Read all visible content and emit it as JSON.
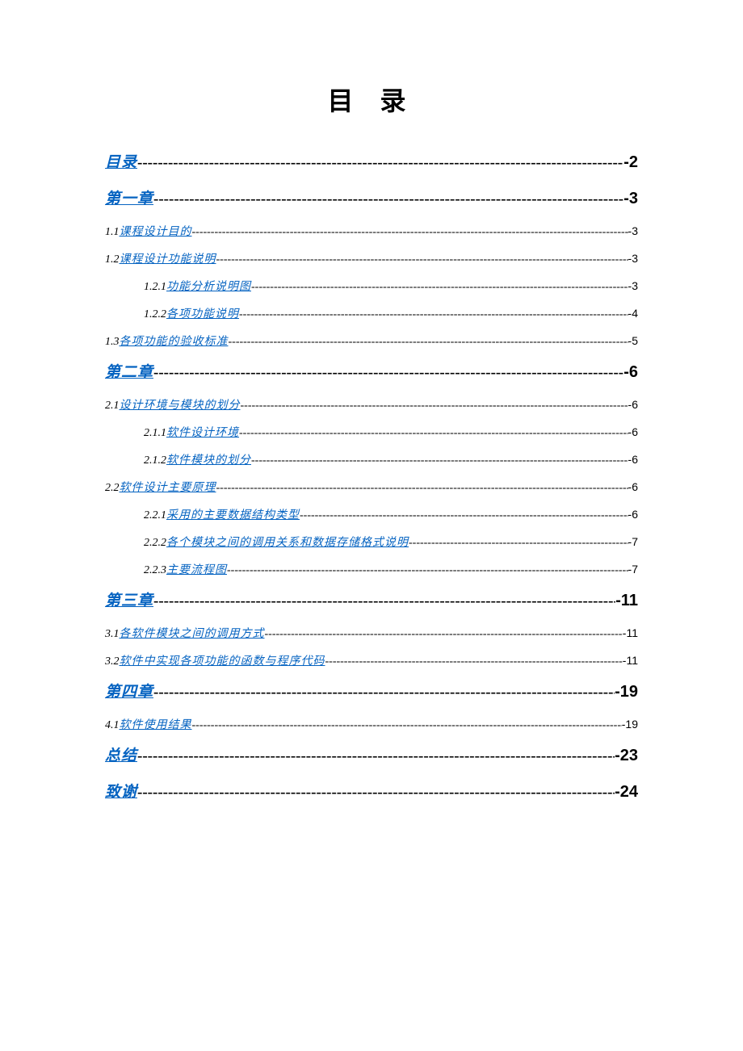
{
  "title": "目 录",
  "entries": [
    {
      "level": 0,
      "prefix": "",
      "label": "目录",
      "page": "2"
    },
    {
      "level": 0,
      "prefix": "",
      "label": "第一章",
      "page": "3"
    },
    {
      "level": 1,
      "prefix": "1.1 ",
      "label": "课程设计目的",
      "page": "3"
    },
    {
      "level": 1,
      "prefix": "1.2 ",
      "label": "课程设计功能说明",
      "page": "3"
    },
    {
      "level": 2,
      "prefix": "1.2.1 ",
      "label": "功能分析说明图",
      "page": "3"
    },
    {
      "level": 2,
      "prefix": "1.2.2 ",
      "label": "各项功能说明",
      "page": "4"
    },
    {
      "level": 1,
      "prefix": "1.3 ",
      "label": "各项功能的验收标准",
      "page": "5"
    },
    {
      "level": 0,
      "prefix": "",
      "label": "第二章",
      "page": "6"
    },
    {
      "level": 1,
      "prefix": "2.1 ",
      "label": "设计环境与模块的划分",
      "page": "6"
    },
    {
      "level": 2,
      "prefix": "2.1.1 ",
      "label": "软件设计环境",
      "page": "6"
    },
    {
      "level": 2,
      "prefix": "2.1.2 ",
      "label": "软件模块的划分",
      "page": "6"
    },
    {
      "level": 1,
      "prefix": "2.2 ",
      "label": "软件设计主要原理",
      "page": "6"
    },
    {
      "level": 2,
      "prefix": "2.2.1 ",
      "label": "采用的主要数据结构类型",
      "page": "6"
    },
    {
      "level": 2,
      "prefix": "2.2.2 ",
      "label": "各个模块之间的调用关系和数据存储格式说明",
      "page": "7"
    },
    {
      "level": 2,
      "prefix": "2.2.3 ",
      "label": "主要流程图",
      "page": "7"
    },
    {
      "level": 0,
      "prefix": "",
      "label": "第三章",
      "page": "11"
    },
    {
      "level": 1,
      "prefix": "3.1 ",
      "label": "各软件模块之间的调用方式",
      "page": "11"
    },
    {
      "level": 1,
      "prefix": "3.2 ",
      "label": "软件中实现各项功能的函数与程序代码",
      "page": "11"
    },
    {
      "level": 0,
      "prefix": "",
      "label": "第四章",
      "page": "19"
    },
    {
      "level": 1,
      "prefix": "4.1 ",
      "label": "软件使用结果",
      "page": "19"
    },
    {
      "level": 0,
      "prefix": "",
      "label": "总结",
      "page": "23"
    },
    {
      "level": 0,
      "prefix": "",
      "label": "致谢",
      "page": "24"
    }
  ]
}
